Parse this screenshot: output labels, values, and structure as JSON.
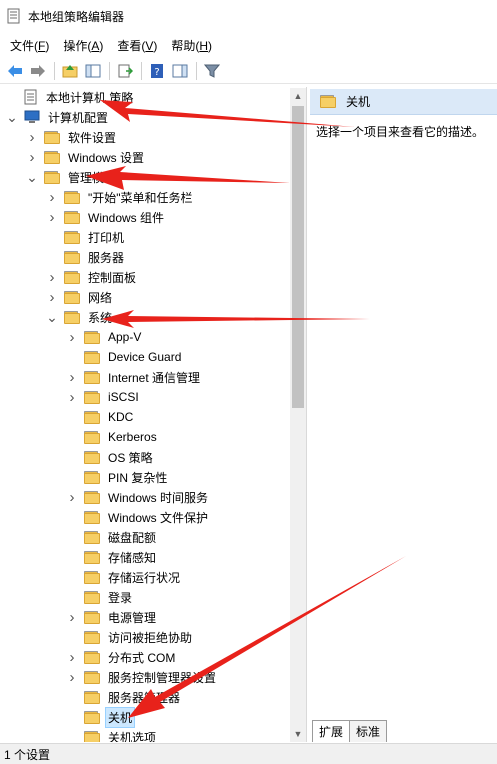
{
  "window": {
    "title": "本地组策略编辑器"
  },
  "menu": [
    {
      "text": "文件(",
      "key": "F",
      "end": ")"
    },
    {
      "text": "操作(",
      "key": "A",
      "end": ")"
    },
    {
      "text": "查看(",
      "key": "V",
      "end": ")"
    },
    {
      "text": "帮助(",
      "key": "H",
      "end": ")"
    }
  ],
  "toolbar": {
    "buttons": [
      "back-icon",
      "forward-icon",
      "up-folder-icon",
      "show-hide-tree-icon",
      "export-list-icon",
      "help-icon",
      "action-pane-icon",
      "filter-icon"
    ]
  },
  "tree": [
    {
      "label": "本地计算机 策略",
      "level": 0,
      "expander": "",
      "icon": "policy-icon"
    },
    {
      "label": "计算机配置",
      "level": 0,
      "expander": "open",
      "icon": "computer-icon"
    },
    {
      "label": "软件设置",
      "level": 1,
      "expander": "closed",
      "icon": "folder-icon"
    },
    {
      "label": "Windows 设置",
      "level": 1,
      "expander": "closed",
      "icon": "folder-icon"
    },
    {
      "label": "管理模板",
      "level": 1,
      "expander": "open",
      "icon": "folder-icon"
    },
    {
      "label": "\"开始\"菜单和任务栏",
      "level": 2,
      "expander": "closed",
      "icon": "folder-icon"
    },
    {
      "label": "Windows 组件",
      "level": 2,
      "expander": "closed",
      "icon": "folder-icon"
    },
    {
      "label": "打印机",
      "level": 2,
      "expander": "",
      "icon": "folder-icon"
    },
    {
      "label": "服务器",
      "level": 2,
      "expander": "",
      "icon": "folder-icon"
    },
    {
      "label": "控制面板",
      "level": 2,
      "expander": "closed",
      "icon": "folder-icon"
    },
    {
      "label": "网络",
      "level": 2,
      "expander": "closed",
      "icon": "folder-icon"
    },
    {
      "label": "系统",
      "level": 2,
      "expander": "open",
      "icon": "folder-icon"
    },
    {
      "label": "App-V",
      "level": 3,
      "expander": "closed",
      "icon": "folder-icon"
    },
    {
      "label": "Device Guard",
      "level": 3,
      "expander": "",
      "icon": "folder-icon"
    },
    {
      "label": "Internet 通信管理",
      "level": 3,
      "expander": "closed",
      "icon": "folder-icon"
    },
    {
      "label": "iSCSI",
      "level": 3,
      "expander": "closed",
      "icon": "folder-icon"
    },
    {
      "label": "KDC",
      "level": 3,
      "expander": "",
      "icon": "folder-icon"
    },
    {
      "label": "Kerberos",
      "level": 3,
      "expander": "",
      "icon": "folder-icon"
    },
    {
      "label": "OS 策略",
      "level": 3,
      "expander": "",
      "icon": "folder-icon"
    },
    {
      "label": "PIN 复杂性",
      "level": 3,
      "expander": "",
      "icon": "folder-icon"
    },
    {
      "label": "Windows 时间服务",
      "level": 3,
      "expander": "closed",
      "icon": "folder-icon"
    },
    {
      "label": "Windows 文件保护",
      "level": 3,
      "expander": "",
      "icon": "folder-icon"
    },
    {
      "label": "磁盘配额",
      "level": 3,
      "expander": "",
      "icon": "folder-icon"
    },
    {
      "label": "存储感知",
      "level": 3,
      "expander": "",
      "icon": "folder-icon"
    },
    {
      "label": "存储运行状况",
      "level": 3,
      "expander": "",
      "icon": "folder-icon"
    },
    {
      "label": "登录",
      "level": 3,
      "expander": "",
      "icon": "folder-icon"
    },
    {
      "label": "电源管理",
      "level": 3,
      "expander": "closed",
      "icon": "folder-icon"
    },
    {
      "label": "访问被拒绝协助",
      "level": 3,
      "expander": "",
      "icon": "folder-icon"
    },
    {
      "label": "分布式 COM",
      "level": 3,
      "expander": "closed",
      "icon": "folder-icon"
    },
    {
      "label": "服务控制管理器设置",
      "level": 3,
      "expander": "closed",
      "icon": "folder-icon"
    },
    {
      "label": "服务器管理器",
      "level": 3,
      "expander": "",
      "icon": "folder-icon"
    },
    {
      "label": "关机",
      "level": 3,
      "expander": "",
      "icon": "folder-icon",
      "selected": true
    },
    {
      "label": "关机选项",
      "level": 3,
      "expander": "",
      "icon": "folder-icon"
    }
  ],
  "right": {
    "header": "关机",
    "description": "选择一个项目来查看它的描述。"
  },
  "tabs": [
    "扩展",
    "标准"
  ],
  "status": "1 个设置",
  "colors": {
    "annotation_arrow": "#e8221b",
    "selection": "#cce8ff",
    "folder": "#f6cf66"
  }
}
